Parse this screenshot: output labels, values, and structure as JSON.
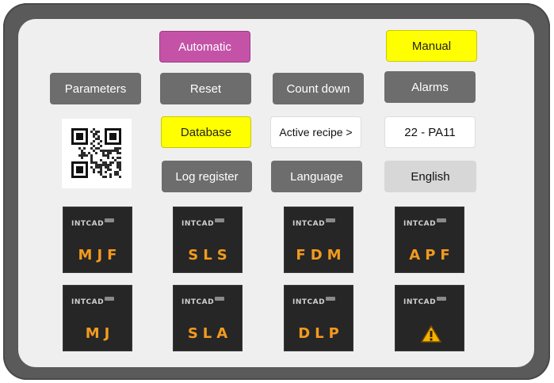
{
  "buttons": {
    "automatic": "Automatic",
    "manual": "Manual",
    "parameters": "Parameters",
    "reset": "Reset",
    "countdown": "Count down",
    "alarms": "Alarms",
    "database": "Database",
    "active_recipe": "Active recipe >",
    "recipe_value": "22 - PA11",
    "log_register": "Log register",
    "language": "Language",
    "language_value": "English"
  },
  "tiles": {
    "mjf": "MJF",
    "sls": "SLS",
    "fdm": "FDM",
    "apf": "APF",
    "mj": "MJ",
    "sla": "SLA",
    "dlp": "DLP"
  },
  "colors": {
    "accent_yellow": "#ffff00",
    "accent_magenta": "#c453a8",
    "button_gray": "#6d6d6d",
    "tile_text_orange": "#f39a1e"
  },
  "icons": {
    "qr": "qr-code-icon",
    "warning": "warning-icon"
  }
}
